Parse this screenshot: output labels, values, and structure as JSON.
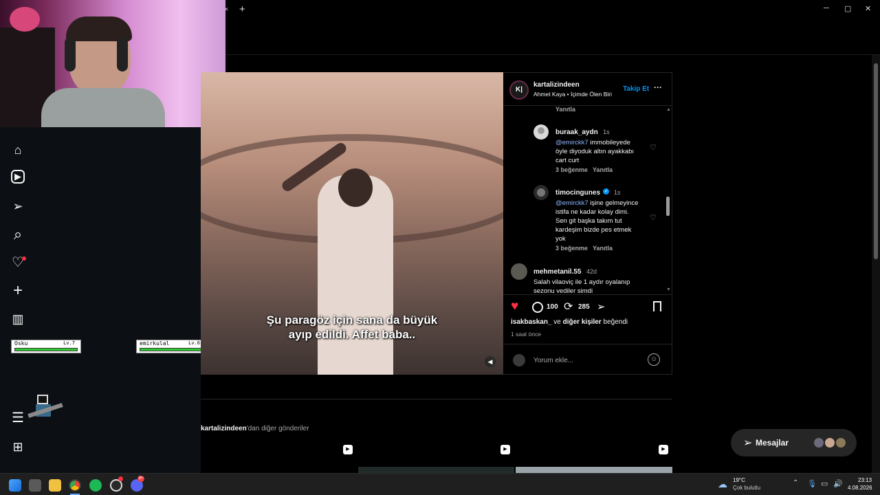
{
  "browser": {
    "new_tab_symbol": "+",
    "close_tab_symbol": "×",
    "window_min": "─",
    "window_max": "▢",
    "window_close": "✕"
  },
  "sidebar": {
    "items": [
      {
        "icon": "home-icon",
        "glyph": "⌂"
      },
      {
        "icon": "reels-icon",
        "glyph": "▶"
      },
      {
        "icon": "direct-icon",
        "glyph": "➢"
      },
      {
        "icon": "search-icon",
        "glyph": "⌕"
      },
      {
        "icon": "notifications-icon",
        "glyph": "♡"
      },
      {
        "icon": "create-icon",
        "glyph": "+"
      },
      {
        "icon": "dashboard-icon",
        "glyph": "▥"
      }
    ],
    "more_icon": "☰",
    "apps_icon": "⊞"
  },
  "overlay": {
    "player1": {
      "name": "Osku",
      "level": "Lv.7"
    },
    "player2": {
      "name": "emirkulal",
      "level": "Lv.6"
    }
  },
  "video": {
    "subtitle_line1": "Şu paragöz için sana da büyük",
    "subtitle_line2": "ayıp edildi. Affet baba.."
  },
  "post": {
    "avatar_text": "K|",
    "username": "kartalizindeen",
    "audio": "Ahmet Kaya • İçimde Ölen Biri",
    "follow_label": "Takip Et",
    "more_label": "···",
    "reply_top": "Yanıtla",
    "comments": [
      {
        "username": "buraak_aydn",
        "time": "1s",
        "mention": "@emirckk7",
        "text": " immobileyede öyle diyoduk altın ayakkabı cart curt",
        "likes": "3 beğenme",
        "reply": "Yanıtla"
      },
      {
        "username": "timocingunes",
        "time": "1s",
        "mention": "@emirckk7",
        "text": " işine gelmeyince istifa ne kadar kolay dimi. Sen git başka takım tut kardeşim bizde pes etmek yok",
        "likes": "3 beğenme",
        "reply": "Yanıtla"
      },
      {
        "username": "mehmetanil.55",
        "time": "42d",
        "text": "Salah vilaoviç ile 1 aydır oyalanıp sezonu yediler şimdi"
      }
    ],
    "actions": {
      "comment_count": "100",
      "repost_count": "285"
    },
    "liked_by_user": "isakbaskan_",
    "liked_by_connector": " ve ",
    "liked_by_others": "diğer kişiler",
    "liked_by_suffix": " beğendi",
    "time_ago": "1 saat önce",
    "comment_placeholder": "Yorum ekle..."
  },
  "more_posts": {
    "username": "kartalizindeen",
    "suffix": "'dan diğer gönderiler"
  },
  "messages": {
    "label": "Mesajlar"
  },
  "taskbar": {
    "weather_temp": "19°C",
    "weather_desc": "Çok bulutlu",
    "time": "23:13",
    "date": "4.08.2026",
    "discord_badge": "9+"
  },
  "colors": {
    "accent_blue": "#0095f6",
    "like_red": "#ff3040",
    "panel_bg": "#000000"
  }
}
